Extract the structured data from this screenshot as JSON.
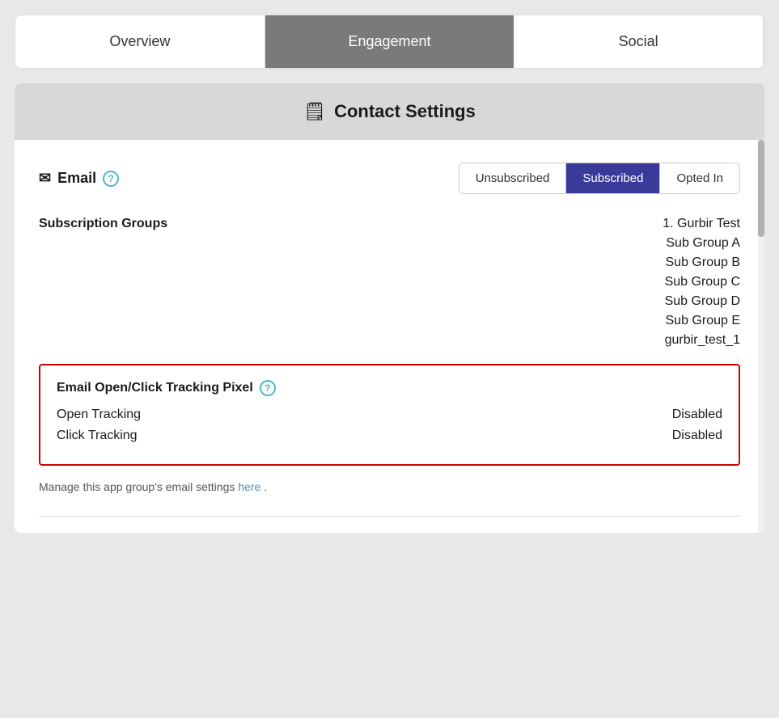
{
  "tabs": [
    {
      "id": "overview",
      "label": "Overview",
      "active": false
    },
    {
      "id": "engagement",
      "label": "Engagement",
      "active": true
    },
    {
      "id": "social",
      "label": "Social",
      "active": false
    }
  ],
  "contact_settings": {
    "title": "Contact Settings",
    "icon": "📋"
  },
  "email_section": {
    "label": "Email",
    "help_icon": "?",
    "toggle_options": [
      {
        "id": "unsubscribed",
        "label": "Unsubscribed",
        "active": false
      },
      {
        "id": "subscribed",
        "label": "Subscribed",
        "active": true
      },
      {
        "id": "opted_in",
        "label": "Opted In",
        "active": false
      }
    ]
  },
  "subscription_groups": {
    "label": "Subscription Groups",
    "groups": [
      "1. Gurbir Test",
      "Sub Group A",
      "Sub Group B",
      "Sub Group C",
      "Sub Group D",
      "Sub Group E",
      "gurbir_test_1"
    ]
  },
  "tracking_section": {
    "title": "Email Open/Click Tracking Pixel",
    "help_icon": "?",
    "items": [
      {
        "label": "Open Tracking",
        "value": "Disabled"
      },
      {
        "label": "Click Tracking",
        "value": "Disabled"
      }
    ]
  },
  "footer": {
    "text_before": "Manage this app group's email settings",
    "link_text": "here",
    "text_after": "."
  }
}
